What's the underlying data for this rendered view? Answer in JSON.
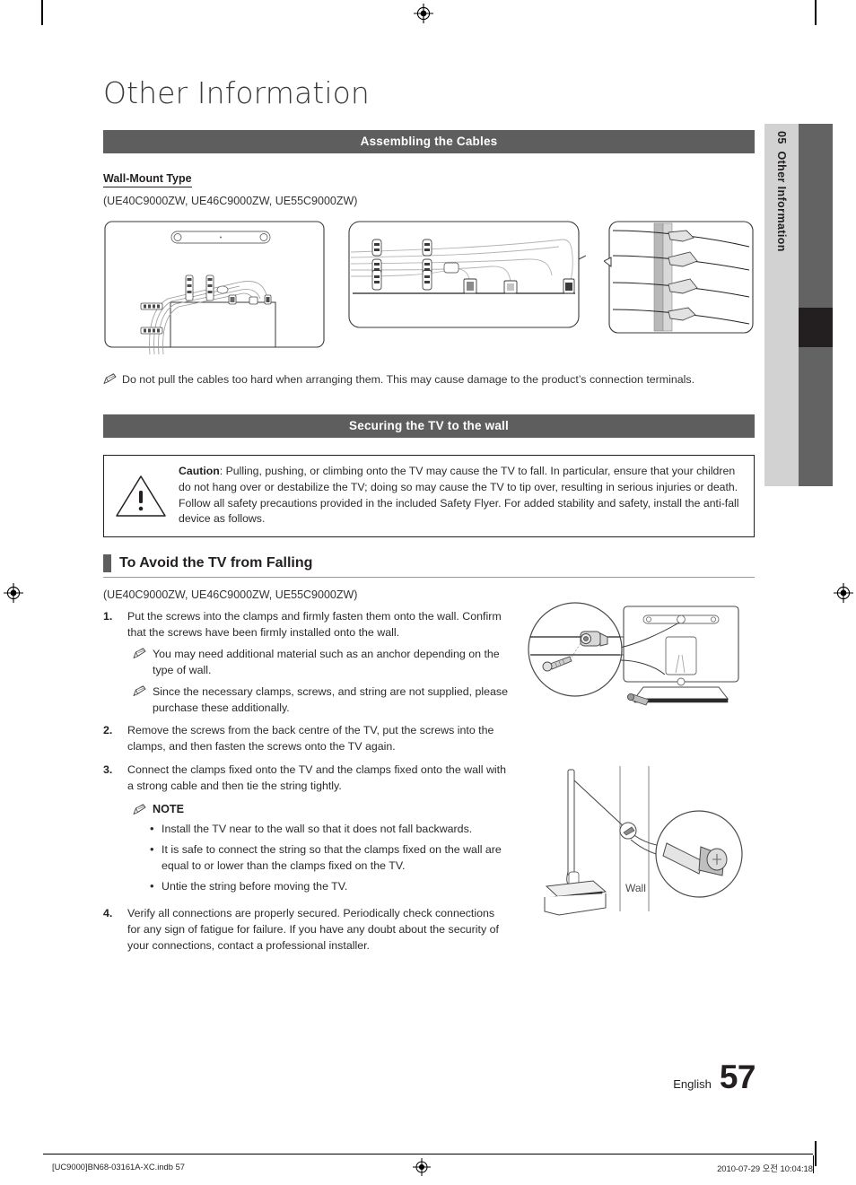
{
  "document": {
    "chapter_number": "05",
    "chapter_name": "Other Information",
    "page_title": "Other Information",
    "language": "English",
    "page_number": "57"
  },
  "section_cables": {
    "bar_title": "Assembling the Cables",
    "subhead": "Wall-Mount Type",
    "models": "(UE40C9000ZW, UE46C9000ZW, UE55C9000ZW)",
    "note": "Do not pull the cables too hard when arranging them. This may cause damage to the product’s connection terminals."
  },
  "section_securing": {
    "bar_title": "Securing the TV to the wall",
    "caution_label": "Caution",
    "caution_text": ": Pulling, pushing, or climbing onto the TV may cause the TV to fall. In particular, ensure that your children do not hang over or destabilize the TV; doing so may cause the TV to tip over, resulting in serious injuries or death. Follow all safety precautions provided in the included Safety Flyer. For added stability and safety, install the anti-fall device as follows."
  },
  "section_avoid_falling": {
    "heading": "To Avoid the TV from Falling",
    "models": "(UE40C9000ZW, UE46C9000ZW, UE55C9000ZW)",
    "steps": [
      {
        "number": "1.",
        "text": "Put the screws into the clamps and firmly fasten them onto the wall. Confirm that the screws have been firmly installed onto the wall.",
        "subnotes": [
          "You may need additional material such as an anchor depending on the type of wall.",
          "Since the necessary clamps, screws, and string are not supplied, please purchase these additionally."
        ]
      },
      {
        "number": "2.",
        "text": "Remove the screws from the back centre of the TV, put the screws into the clamps, and then fasten the screws onto the TV again.",
        "subnotes": []
      },
      {
        "number": "3.",
        "text": "Connect the clamps fixed onto the TV and the clamps fixed onto the wall with a strong cable and then tie the string tightly.",
        "subnotes": [],
        "note_label": "NOTE",
        "bullets": [
          "Install the TV near to the wall so that it does not fall backwards.",
          "It is safe to connect the string so that the clamps fixed on the wall are equal to or lower than the clamps fixed on the TV.",
          "Untie the string before moving the TV."
        ]
      },
      {
        "number": "4.",
        "text": "Verify all connections are properly secured. Periodically check connections for any sign of fatigue for failure. If you have any doubt about the security of your connections, contact a professional installer.",
        "subnotes": []
      }
    ],
    "illustration_labels": {
      "wall": "Wall"
    }
  },
  "footer": {
    "file_name": "[UC9000]BN68-03161A-XC.indb   57",
    "timestamp": "2010-07-29   오전 10:04:18"
  },
  "colors": {
    "bar_gray": "#5e5e5e",
    "side_tab_gray": "#d2d2d2",
    "side_block_gray": "#636363",
    "side_block_active": "#231f20",
    "text": "#231f20"
  }
}
